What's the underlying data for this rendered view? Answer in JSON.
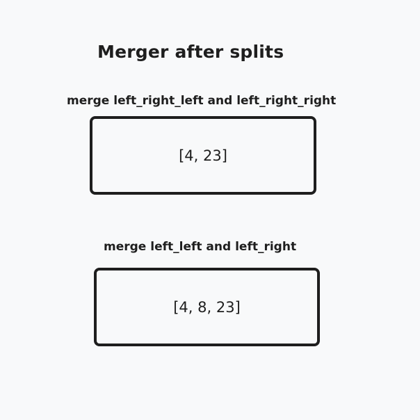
{
  "title": "Merger after splits",
  "steps": [
    {
      "label": "merge left_right_left and left_right_right",
      "value": "[4, 23]"
    },
    {
      "label": "merge left_left and left_right",
      "value": "[4, 8, 23]"
    }
  ]
}
